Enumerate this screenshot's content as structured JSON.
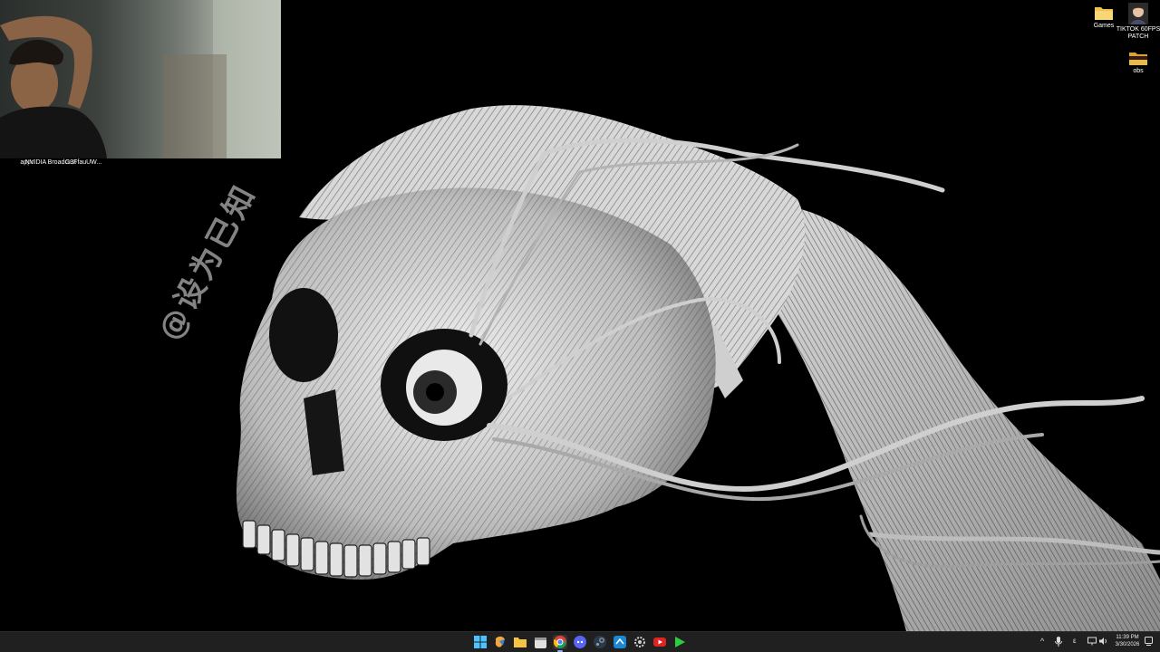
{
  "wallpaper": {
    "watermark_text": "@设为已知",
    "theme_colors": {
      "background": "#000000",
      "ink": "#e8e8e8",
      "shadow": "#1a1a1a"
    }
  },
  "webcam": {
    "description_icon": "webcam-feed"
  },
  "desktop": {
    "left_icons": [
      {
        "label": "apps"
      },
      {
        "label": "NVIDIA Broadcast"
      },
      {
        "label": "G3FfauUW..."
      }
    ],
    "right_icons": [
      {
        "label": "Games",
        "icon": "folder-icon"
      },
      {
        "label": "TIKTOK 60FPS PATCH",
        "icon": "user-avatar-icon"
      },
      {
        "label": "obs",
        "icon": "folder-dark-icon"
      }
    ]
  },
  "taskbar": {
    "apps": [
      {
        "icon": "windows-start-icon",
        "color": "#4cc2ff"
      },
      {
        "icon": "copilot-icon",
        "color": "#f0a83a"
      },
      {
        "icon": "file-explorer-icon",
        "color": "#f4c542"
      },
      {
        "icon": "calendar-store-icon",
        "color": "#e0e0e0"
      },
      {
        "icon": "chrome-icon",
        "color": "#fbbc04"
      },
      {
        "icon": "discord-icon",
        "color": "#5865f2"
      },
      {
        "icon": "steam-icon",
        "color": "#9aa3b0"
      },
      {
        "icon": "steam-blue-icon",
        "color": "#1b88d6"
      },
      {
        "icon": "app-gear-icon",
        "color": "#cfcfcf"
      },
      {
        "icon": "youtube-icon",
        "color": "#e02424"
      },
      {
        "icon": "green-app-icon",
        "color": "#2ecc40"
      }
    ],
    "tray": {
      "chevron_icon": "^",
      "mic_icon": "mic-icon",
      "lang": "ε",
      "time": "11:39 PM",
      "date": "3/30/2026"
    }
  }
}
